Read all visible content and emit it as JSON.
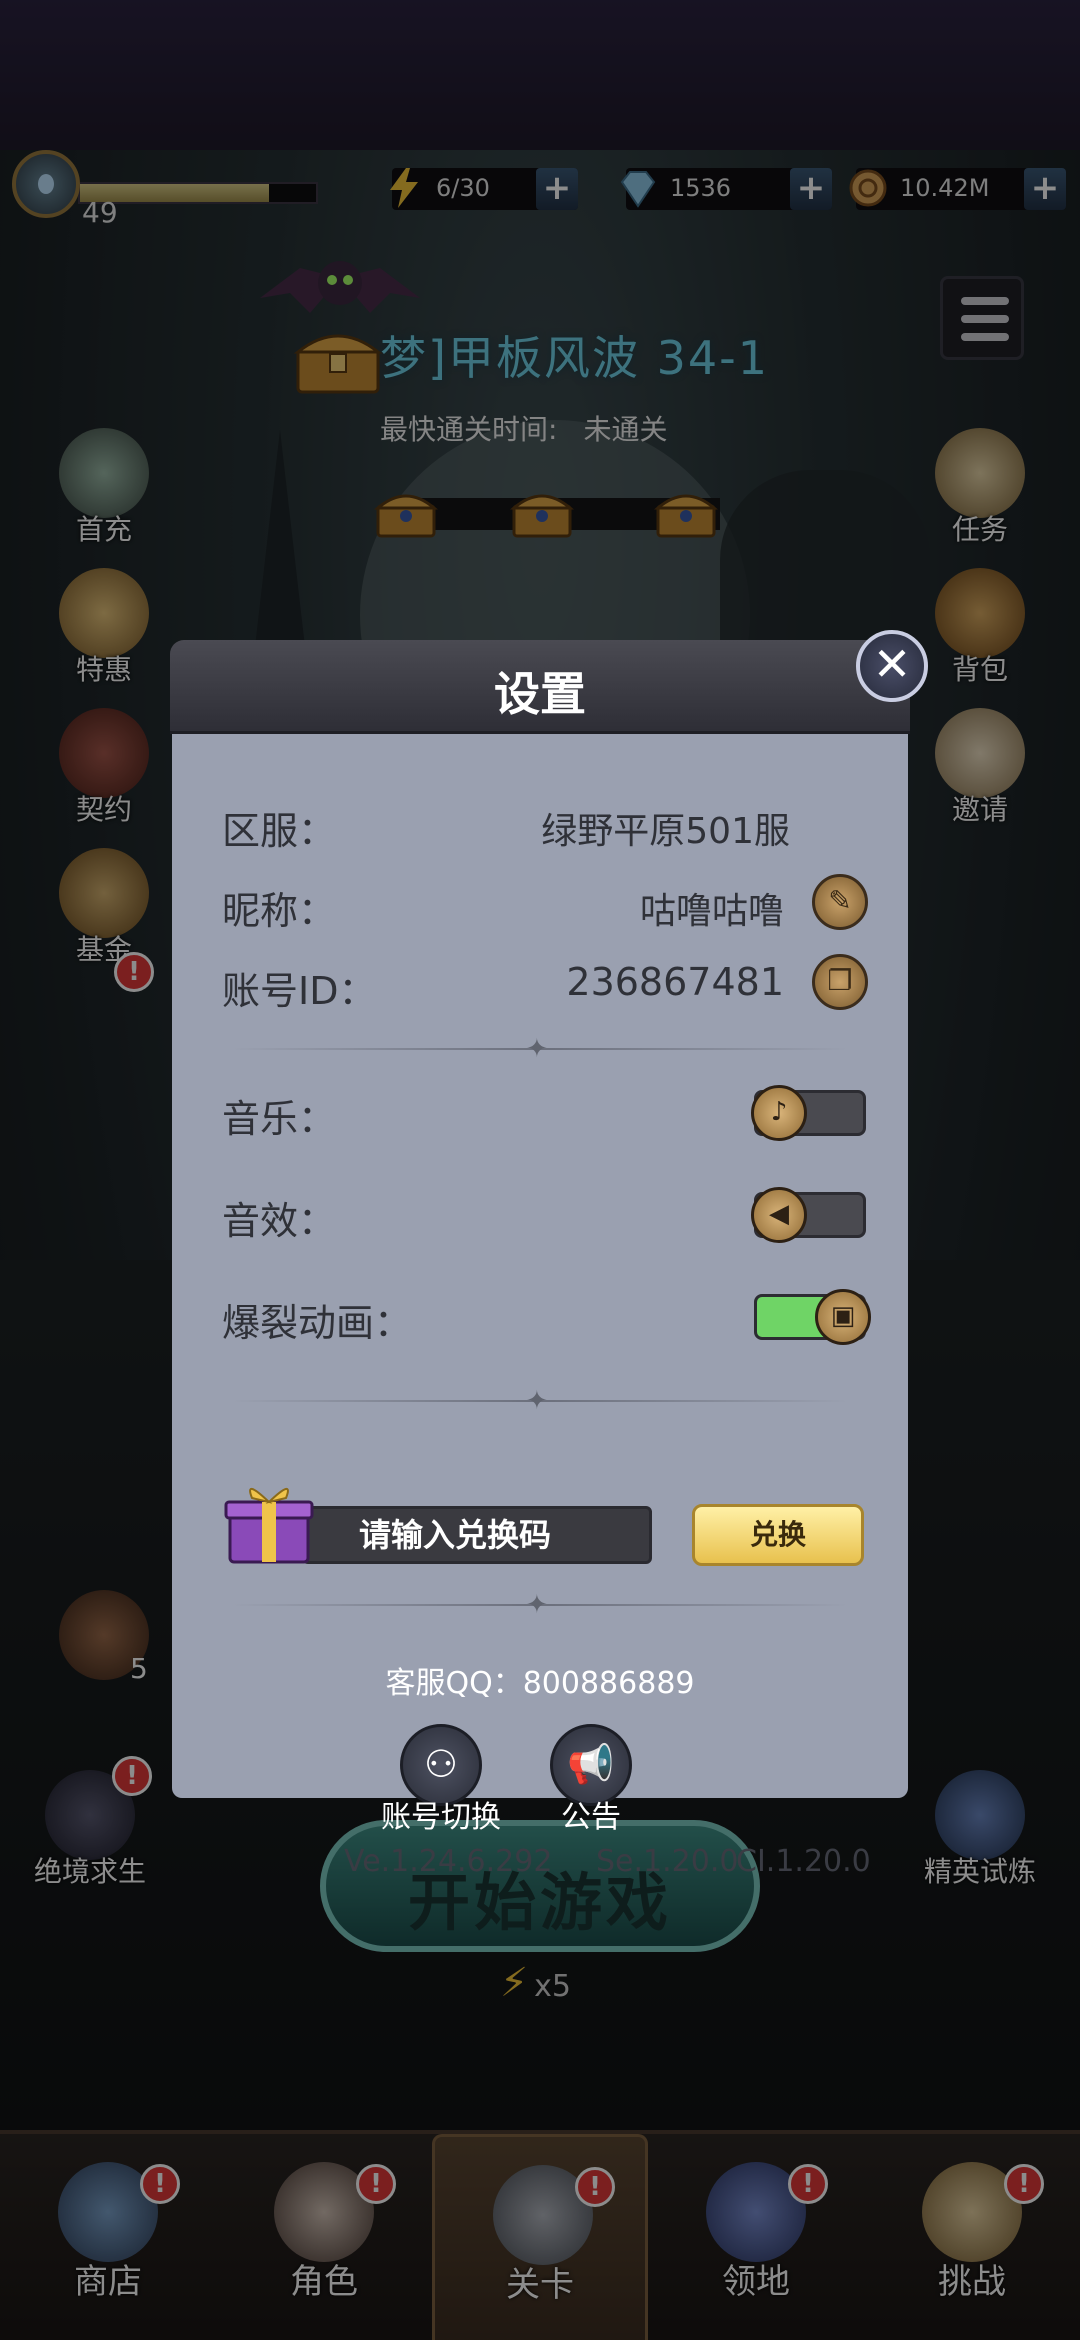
{
  "player": {
    "level": "49",
    "xp_fraction": 0.8
  },
  "resources": [
    {
      "name": "energy",
      "icon": "lightning-icon",
      "value": "6/30"
    },
    {
      "name": "diamond",
      "icon": "diamond-icon",
      "value": "1536"
    },
    {
      "name": "gold",
      "icon": "coin-icon",
      "value": "10.42M"
    }
  ],
  "stage": {
    "title": "梦]甲板风波 34-1",
    "best_time_label": "最快通关时间:",
    "best_time_value": "未通关"
  },
  "left_sidebar": [
    "首充",
    "特惠",
    "契约",
    "基金"
  ],
  "right_sidebar": [
    "任务",
    "背包",
    "邀请"
  ],
  "side_bottom": {
    "left": "绝境求生",
    "right": "精英试炼",
    "stack_count": "5"
  },
  "start": {
    "label": "开始游戏",
    "cost": "x5"
  },
  "bottom_nav": [
    {
      "label": "商店",
      "alert": "!"
    },
    {
      "label": "角色",
      "alert": "!"
    },
    {
      "label": "关卡",
      "alert": "!"
    },
    {
      "label": "领地",
      "alert": "!"
    },
    {
      "label": "挑战",
      "alert": "!"
    }
  ],
  "settings": {
    "title": "设置",
    "close_label": "✕",
    "server_label": "区服：",
    "server_value": "绿野平原501服",
    "nickname_label": "昵称：",
    "nickname_value": "咕噜咕噜",
    "account_label": "账号ID：",
    "account_value": "236867481",
    "music_label": "音乐：",
    "music_on": false,
    "sfx_label": "音效：",
    "sfx_on": false,
    "burst_label": "爆裂动画：",
    "burst_on": true,
    "code_placeholder": "请输入兑换码",
    "redeem_label": "兑换",
    "support_label": "客服QQ：800886889",
    "switch_account_label": "账号切换",
    "notice_label": "公告",
    "version_client": "Ve.1.24.6.292",
    "version_server": "Se.1.20.0",
    "version_ci": "CI.1.20.0"
  },
  "colors": {
    "accent": "#6fd0e6",
    "alert": "#e03a3a",
    "toggle_on": "#6fd466",
    "dialog_bg": "#9aa0b0"
  }
}
